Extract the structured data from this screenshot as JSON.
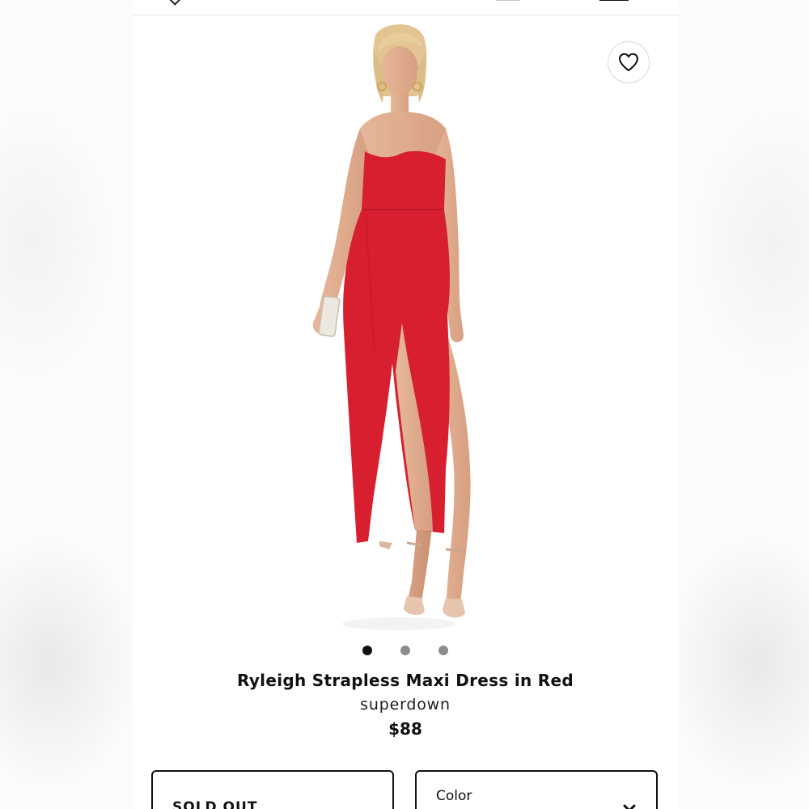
{
  "product": {
    "title": "Ryleigh Strapless Maxi Dress in Red",
    "brand": "superdown",
    "price": "$88"
  },
  "gallery": {
    "image_count": 3,
    "active_index": 0,
    "dress_color": "#d81f2f"
  },
  "icons": {
    "favorite": "heart-outline-icon",
    "color_clear": "close-icon"
  },
  "size_select": {
    "value": "SOLD OUT"
  },
  "color_select": {
    "label": "Color"
  }
}
